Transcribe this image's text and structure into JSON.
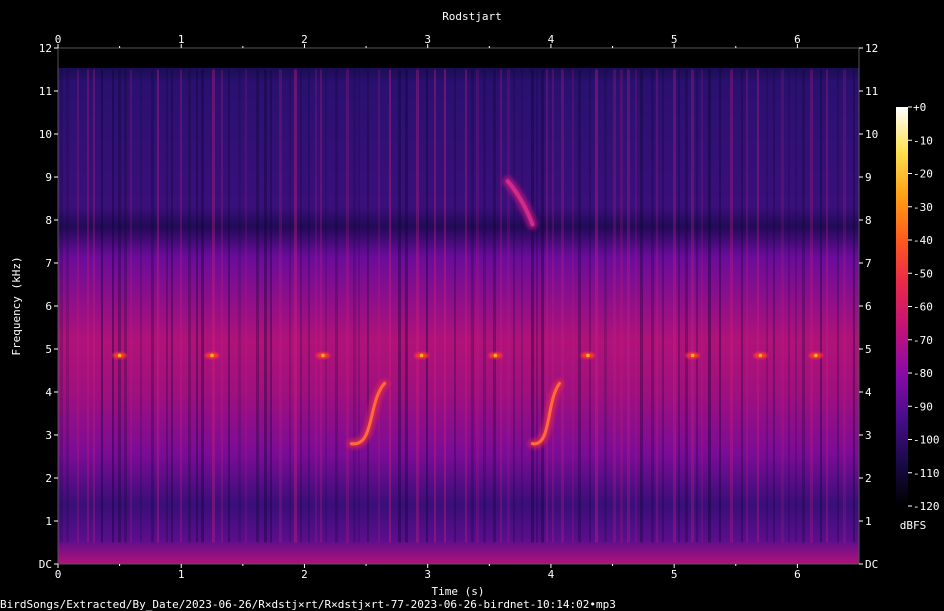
{
  "chart_data": {
    "type": "heatmap",
    "title": "Rodstjart",
    "xlabel": "Time (s)",
    "ylabel": "Frequency (kHz)",
    "xlim": [
      0,
      6.5
    ],
    "ylim": [
      0,
      12
    ],
    "x_ticks": [
      0,
      1,
      2,
      3,
      4,
      5,
      6
    ],
    "y_ticks": [
      "DC",
      "1",
      "2",
      "3",
      "4",
      "5",
      "6",
      "7",
      "8",
      "9",
      "10",
      "11",
      "12"
    ],
    "colorbar": {
      "label": "dBFS",
      "range": [
        -120,
        0
      ],
      "ticks": [
        "+0",
        "-10",
        "-20",
        "-30",
        "-40",
        "-50",
        "-60",
        "-70",
        "-80",
        "-90",
        "-100",
        "-110",
        "-120"
      ],
      "colors": [
        "#000000",
        "#1a0a4a",
        "#4a0c8c",
        "#8a0aa8",
        "#c2127a",
        "#e8284a",
        "#ff5a1e",
        "#ffa014",
        "#ffe050",
        "#ffffff"
      ]
    },
    "grid": false,
    "legend": "right",
    "features": [
      {
        "name": "call-1",
        "t_start": 2.38,
        "t_end": 2.65,
        "f_start_khz": 2.8,
        "f_end_khz": 4.2
      },
      {
        "name": "call-2",
        "t_start": 3.85,
        "t_end": 4.07,
        "f_start_khz": 2.8,
        "f_end_khz": 4.2
      },
      {
        "name": "high-sweep",
        "t_start": 3.65,
        "t_end": 3.85,
        "f_start_khz": 8.9,
        "f_end_khz": 7.9
      },
      {
        "name": "tone-4-9khz",
        "freq_khz": 4.85,
        "times": [
          0.5,
          1.25,
          2.15,
          2.95,
          3.55,
          4.3,
          5.15,
          5.7,
          6.15
        ]
      }
    ]
  },
  "footer": {
    "path": "BirdSongs/Extracted/By_Date/2023-06-26/R×dstj×rt/R×dstj×rt-77-2023-06-26-birdnet-10:14:02•mp3"
  }
}
